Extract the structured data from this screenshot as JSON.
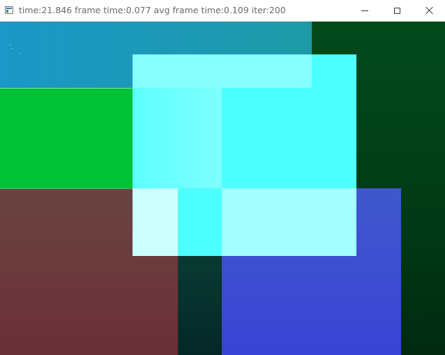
{
  "window": {
    "title": "time:21.846 frame time:0.077 avg frame time:0.109 iter:200",
    "icon": "app-window-icon"
  },
  "controls": {
    "minimize_icon": "minimize-icon",
    "maximize_icon": "maximize-icon",
    "close_icon": "close-icon"
  },
  "canvas": {
    "colors": {
      "top_blue": "#1b97c8",
      "green": "#00c236",
      "maroon": "#6a2f38",
      "cyan": "#4dfffe",
      "pale_cyan": "#ccffff",
      "light_cyan": "#a2fffe",
      "blue": "#3a44d6",
      "dark_green": "#024a1c"
    }
  }
}
